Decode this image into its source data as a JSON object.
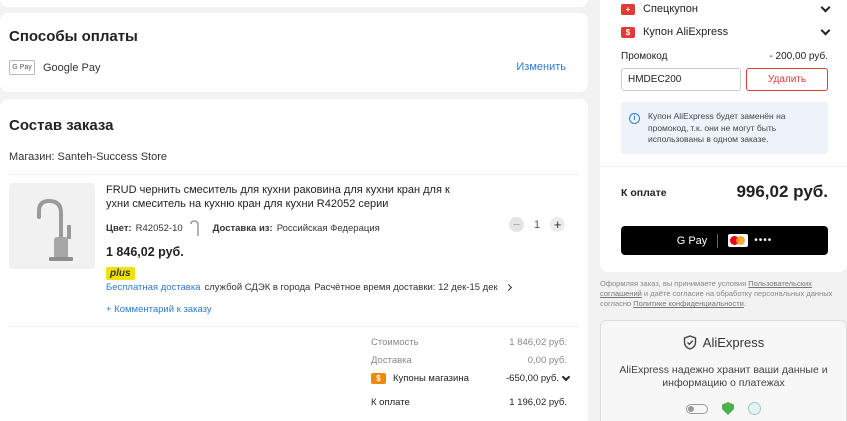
{
  "payment": {
    "title": "Способы оплаты",
    "method_badge": "G Pay",
    "method": "Google Pay",
    "change": "Изменить"
  },
  "order": {
    "title": "Состав заказа",
    "store": "Магазин: Santeh-Success Store",
    "item": {
      "title": "FRUD чернить смеситель для кухни раковина для кухни кран для к ухни смеситель на кухню кран для кухни R42052 серии",
      "color_label": "Цвет:",
      "color_value": "R42052-10",
      "delivery_label": "Доставка из:",
      "delivery_value": "Российская Федерация",
      "qty": "1",
      "price": "1 846,02 руб.",
      "plus": "plus",
      "free_delivery": "Бесплатная доставка",
      "delivery_service": "службой СДЭК в города",
      "delivery_time": "Расчётное время доставки: 12 дек-15 дек",
      "comment": "+ Комментарий к заказу"
    },
    "summary": {
      "cost_label": "Стоимость",
      "cost_value": "1 846,02 руб.",
      "delivery_label": "Доставка",
      "delivery_value": "0,00 руб.",
      "coupons_label": "Купоны магазина",
      "coupons_value": "-650,00 руб.",
      "total_label": "К оплате",
      "total_value": "1 196,02 руб."
    }
  },
  "sidebar": {
    "spec_coupon": "Спецкупон",
    "ae_coupon": "Купон AliExpress",
    "promo_label": "Промокод",
    "promo_value": "- 200,00 руб.",
    "promo_code": "HMDEC200",
    "remove": "Удалить",
    "info": "Купон AliExpress будет заменён на промокод, т.к. они не могут быть использованы в одном заказе.",
    "to_pay_label": "К оплате",
    "to_pay_value": "996,02 руб.",
    "gpay_label": "G Pay",
    "card_mask": "••••",
    "legal_1": "Оформляя заказ, вы принимаете условия ",
    "legal_link1": "Пользовательских соглашений",
    "legal_2": " и даёте согласие на обработку персональных данных согласно ",
    "legal_link2": "Политике конфиденциальности",
    "legal_3": ".",
    "brand": "AliExpress",
    "secure_text": "AliExpress надежно хранит ваши данные и информацию о платежах"
  },
  "colors": {
    "accent_red": "#e53935",
    "link_blue": "#2e7bd6",
    "coupon_orange": "#f08a0a",
    "plus_yellow": "#f3e100"
  }
}
